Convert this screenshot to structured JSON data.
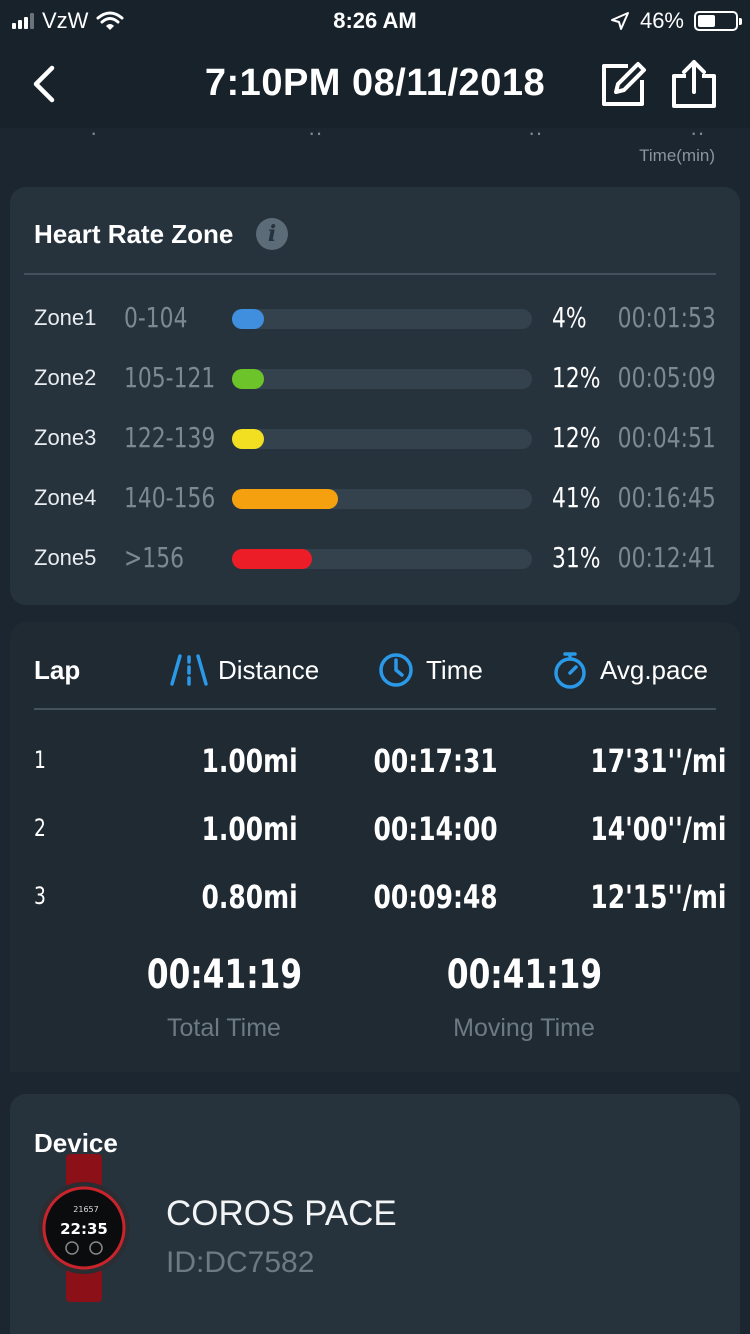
{
  "status_bar": {
    "carrier": "VzW",
    "time": "8:26 AM",
    "battery": "46%",
    "battery_level": 0.46
  },
  "nav": {
    "title": "7:10PM 08/11/2018",
    "back_icon": "chevron-left-icon",
    "edit_icon": "edit-icon",
    "share_icon": "share-icon"
  },
  "chart_remnant": {
    "time_unit_label": "Time(min)"
  },
  "heart_rate_zone": {
    "title": "Heart Rate Zone",
    "info_icon": "info-icon",
    "zones": [
      {
        "name": "Zone1",
        "range": "0-104",
        "percent": "4%",
        "fraction": 0.04,
        "time": "00:01:53",
        "color": "#3f8fde"
      },
      {
        "name": "Zone2",
        "range": "105-121",
        "percent": "12%",
        "fraction": 0.12,
        "time": "00:05:09",
        "color": "#6cc42a"
      },
      {
        "name": "Zone3",
        "range": "122-139",
        "percent": "12%",
        "fraction": 0.12,
        "time": "00:04:51",
        "color": "#f2df22"
      },
      {
        "name": "Zone4",
        "range": "140-156",
        "percent": "41%",
        "fraction": 0.41,
        "time": "00:16:45",
        "color": "#f5a10f"
      },
      {
        "name": "Zone5",
        "range": ">156",
        "percent": "31%",
        "fraction": 0.31,
        "time": "00:12:41",
        "color": "#ec1d26"
      }
    ]
  },
  "laps": {
    "header": {
      "lap": "Lap",
      "distance": "Distance",
      "time": "Time",
      "avg_pace": "Avg.pace"
    },
    "rows": [
      {
        "index": "1",
        "distance": "1.00mi",
        "time": "00:17:31",
        "pace": "17'31''/mi"
      },
      {
        "index": "2",
        "distance": "1.00mi",
        "time": "00:14:00",
        "pace": "14'00''/mi"
      },
      {
        "index": "3",
        "distance": "0.80mi",
        "time": "00:09:48",
        "pace": "12'15''/mi"
      }
    ],
    "total_time": "00:41:19",
    "total_time_label": "Total Time",
    "moving_time": "00:41:19",
    "moving_time_label": "Moving Time"
  },
  "device": {
    "title": "Device",
    "name": "COROS PACE",
    "id": "ID:DC7582",
    "image_icon": "watch-icon"
  },
  "colors": {
    "background": "#1b2630",
    "card": "#26333d",
    "accent_blue": "#2a9ae8"
  }
}
